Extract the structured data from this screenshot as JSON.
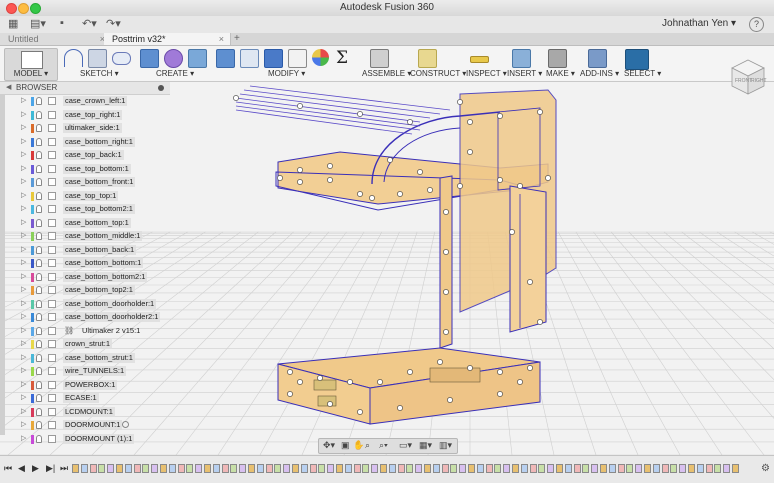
{
  "window": {
    "title": "Autodesk Fusion 360"
  },
  "quick_access": {
    "user": "Johnathan Yen ▾",
    "help": "?"
  },
  "tabs": [
    {
      "label": "Untitled",
      "close": "×"
    },
    {
      "label": "Posttrim v32*",
      "close": "×"
    }
  ],
  "toolbar": {
    "workspace_label": "MODEL ▾",
    "groups": [
      "SKETCH ▾",
      "CREATE ▾",
      "MODIFY ▾",
      "ASSEMBLE ▾",
      "CONSTRUCT ▾",
      "INSPECT ▾",
      "INSERT ▾",
      "MAKE ▾",
      "ADD-INS ▾",
      "SELECT ▾"
    ],
    "sigma": "Σ"
  },
  "browser": {
    "title": "BROWSER",
    "items": [
      {
        "label": "case_crown_left:1",
        "color": "#4ba5e8"
      },
      {
        "label": "case_top_right:1",
        "color": "#3fb9d6"
      },
      {
        "label": "ultimaker_side:1",
        "color": "#d96b2a"
      },
      {
        "label": "case_bottom_right:1",
        "color": "#3a78d8"
      },
      {
        "label": "case_top_back:1",
        "color": "#d93a3a"
      },
      {
        "label": "case_top_bottom:1",
        "color": "#6a5ad8"
      },
      {
        "label": "case_bottom_front:1",
        "color": "#5a9ad8"
      },
      {
        "label": "case_top_top:1",
        "color": "#e8c83a"
      },
      {
        "label": "case_top_bottom2:1",
        "color": "#4bb8e0"
      },
      {
        "label": "case_bottom_top:1",
        "color": "#7a5ad0"
      },
      {
        "label": "case_bottom_middle:1",
        "color": "#8ad05a"
      },
      {
        "label": "case_bottom_back:1",
        "color": "#4b9ad8"
      },
      {
        "label": "case_bottom_bottom:1",
        "color": "#3a58c8"
      },
      {
        "label": "case_bottom_bottom2:1",
        "color": "#d84a9a"
      },
      {
        "label": "case_bottom_top2:1",
        "color": "#e89a3a"
      },
      {
        "label": "case_bottom_doorholder:1",
        "color": "#5ac8a8"
      },
      {
        "label": "case_bottom_doorholder2:1",
        "color": "#3a8ad8"
      },
      {
        "label": "Ultimaker 2 v15:1",
        "color": "#5aa8e8",
        "linked": true
      },
      {
        "label": "crown_strut:1",
        "color": "#e8d84a"
      },
      {
        "label": "case_bottom_strut:1",
        "color": "#4ab8d8"
      },
      {
        "label": "wire_TUNNELS:1",
        "color": "#9ad84a"
      },
      {
        "label": "POWERBOX:1",
        "color": "#d85a3a"
      },
      {
        "label": "ECASE:1",
        "color": "#3a6ad8"
      },
      {
        "label": "LCDMOUNT:1",
        "color": "#d83a5a"
      },
      {
        "label": "DOORMOUNT:1",
        "color": "#e8a83a",
        "circle": true
      },
      {
        "label": "DOORMOUNT (1):1",
        "color": "#c84ad8"
      }
    ]
  },
  "viewcube": {
    "top": "TOP",
    "front": "FRONT",
    "right": "RIGHT"
  },
  "colors": {
    "part_fill": "#f0c98a",
    "edge": "#3a2fb8",
    "grid": "#c9c9c9"
  }
}
